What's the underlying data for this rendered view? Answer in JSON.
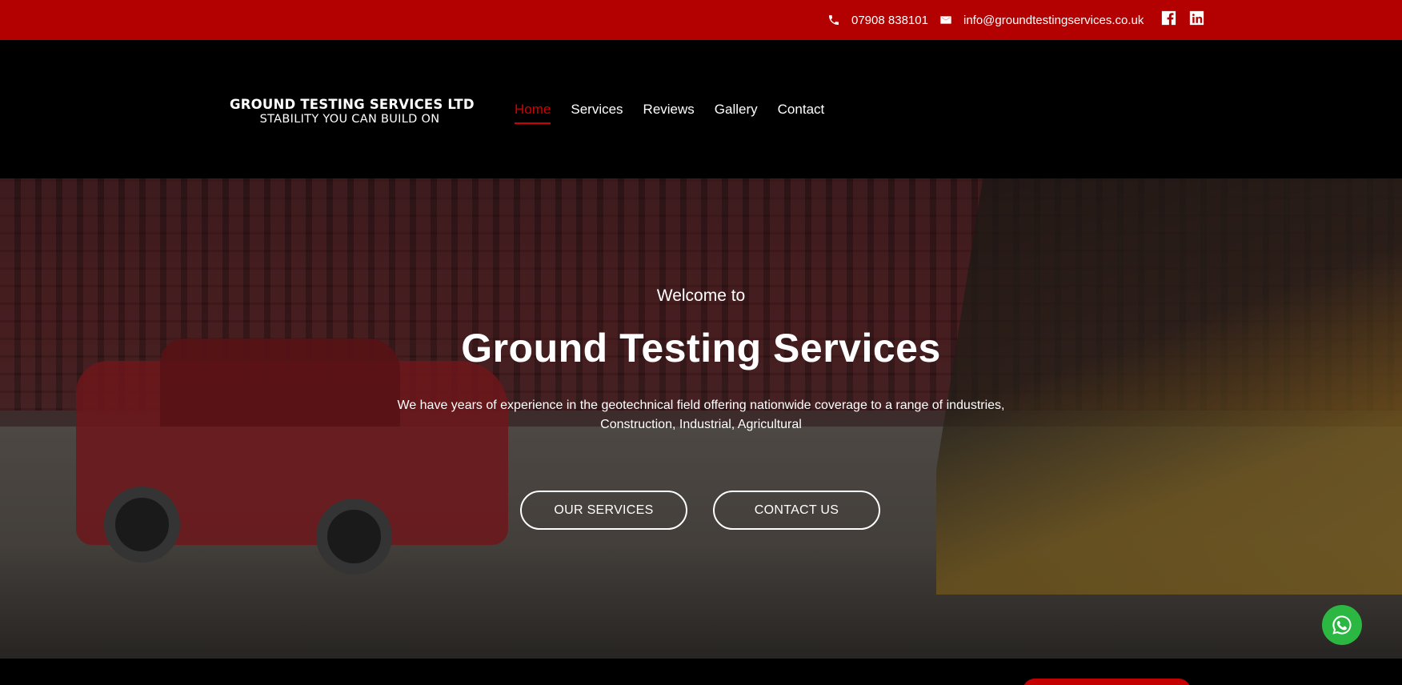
{
  "topbar": {
    "phone": "07908 838101",
    "email": "info@groundtestingservices.co.uk",
    "bg_color": "#b30000"
  },
  "header": {
    "logo_name": "GROUND TESTING SERVICES LTD",
    "logo_tagline": "STABILITY YOU CAN BUILD ON",
    "nav": [
      {
        "label": "Home",
        "active": true
      },
      {
        "label": "Services"
      },
      {
        "label": "Reviews"
      },
      {
        "label": "Gallery"
      },
      {
        "label": "Contact"
      }
    ],
    "active_color": "#d10000"
  },
  "hero": {
    "welcome": "Welcome to",
    "title": "Ground Testing Services",
    "description_line1": "We have years of experience in the geotechnical field offering nationwide coverage to a range of industries,",
    "description_line2": "Construction, Industrial, Agricultural",
    "btn_services": "OUR SERVICES",
    "btn_contact": "CONTACT US"
  },
  "icons": {
    "phone": "phone-icon",
    "email": "envelope-icon",
    "facebook": "facebook-icon",
    "linkedin": "linkedin-icon",
    "whatsapp": "whatsapp-icon"
  },
  "whatsapp_color": "#2bb741"
}
